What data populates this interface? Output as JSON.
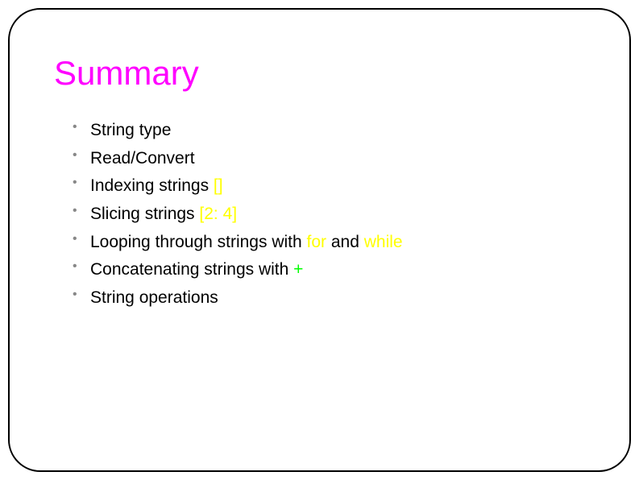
{
  "title": "Summary",
  "bullets": {
    "b0": {
      "text": "String type"
    },
    "b1": {
      "text": "Read/Convert"
    },
    "b2": {
      "prefix": "Indexing strings ",
      "code": "[]"
    },
    "b3": {
      "prefix": "Slicing strings ",
      "code": "[2: 4]"
    },
    "b4": {
      "prefix": "Looping through strings with ",
      "code1": "for",
      "mid": " and ",
      "code2": "while"
    },
    "b5": {
      "prefix": "Concatenating strings with ",
      "code": "+"
    },
    "b6": {
      "text": "String operations"
    }
  }
}
